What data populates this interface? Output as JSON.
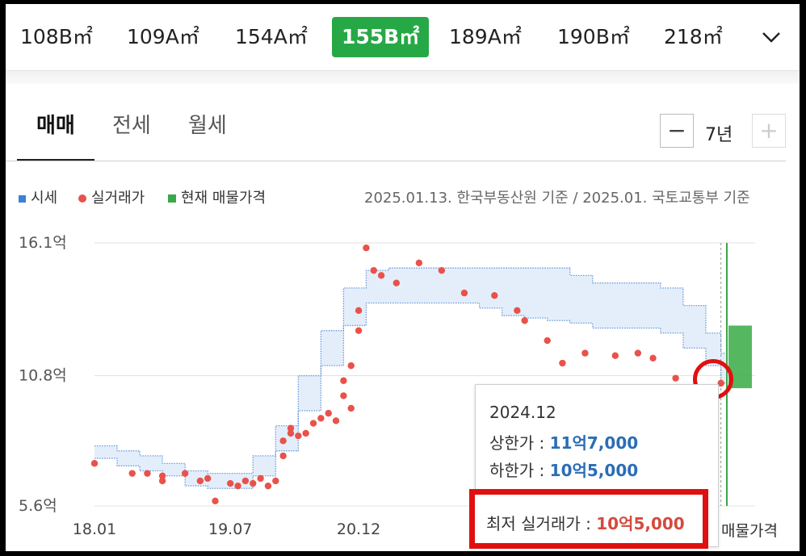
{
  "area_tabs": [
    {
      "label": "108B㎡",
      "active": false
    },
    {
      "label": "109A㎡",
      "active": false
    },
    {
      "label": "154A㎡",
      "active": false
    },
    {
      "label": "155B㎡",
      "active": true
    },
    {
      "label": "189A㎡",
      "active": false
    },
    {
      "label": "190B㎡",
      "active": false
    },
    {
      "label": "218㎡",
      "active": false
    }
  ],
  "deal_tabs": [
    {
      "label": "매매",
      "active": true
    },
    {
      "label": "전세",
      "active": false
    },
    {
      "label": "월세",
      "active": false
    }
  ],
  "period": {
    "minus": "−",
    "value": "7년",
    "plus": "+"
  },
  "legend": {
    "market_price": "시세",
    "actual_deal": "실거래가",
    "current_listing": "현재 매물가격",
    "basis": "2025.01.13. 한국부동산원 기준 / 2025.01. 국토교통부 기준"
  },
  "colors": {
    "accent": "#27a846",
    "market": "#3b82d6",
    "deal": "#e8524a",
    "listing": "#3aa84a",
    "annotation": "#e01010"
  },
  "tooltip": {
    "date": "2024.12",
    "upper_label": "상한가 : ",
    "upper_value": "11억7,000",
    "lower_label": "하한가 : ",
    "lower_value": "10억5,000",
    "min_label": "최저 실거래가 : ",
    "min_value": "10억5,000"
  },
  "chart_data": {
    "type": "scatter",
    "xlabel": "",
    "ylabel": "",
    "x_ticks": [
      "18.01",
      "19.07",
      "20.12"
    ],
    "current_listing_label": "매물가격",
    "y_ticks": [
      "16.1억",
      "10.8억",
      "5.6억"
    ],
    "y_tick_values": [
      16.1,
      10.8,
      5.6
    ],
    "ylim": [
      5.6,
      16.1
    ],
    "xlim": [
      "2018-01",
      "2025-01"
    ],
    "grid": true,
    "market_band": {
      "name": "시세",
      "x": [
        "2018-01",
        "2018-04",
        "2018-07",
        "2018-10",
        "2019-01",
        "2019-04",
        "2019-07",
        "2019-10",
        "2020-01",
        "2020-04",
        "2020-07",
        "2020-10",
        "2021-01",
        "2021-04",
        "2021-07",
        "2021-10",
        "2022-01",
        "2022-04",
        "2022-07",
        "2022-10",
        "2023-01",
        "2023-04",
        "2023-07",
        "2023-10",
        "2024-01",
        "2024-04",
        "2024-07",
        "2024-10",
        "2024-12"
      ],
      "upper": [
        8.0,
        7.8,
        7.6,
        7.3,
        7.0,
        6.9,
        6.9,
        7.6,
        8.8,
        10.8,
        12.6,
        14.3,
        15.0,
        15.1,
        15.1,
        15.1,
        15.1,
        15.1,
        15.1,
        15.1,
        15.1,
        14.8,
        14.5,
        14.5,
        14.5,
        14.3,
        13.6,
        12.5,
        11.7
      ],
      "lower": [
        7.5,
        7.2,
        7.0,
        6.8,
        6.4,
        6.3,
        6.3,
        6.8,
        7.8,
        9.4,
        11.2,
        12.8,
        13.7,
        13.7,
        13.7,
        13.7,
        13.7,
        13.5,
        13.2,
        13.1,
        13.0,
        12.9,
        12.7,
        12.7,
        12.7,
        12.5,
        11.9,
        11.2,
        10.5
      ]
    },
    "series": [
      {
        "name": "실거래가",
        "points": [
          [
            "2018-01",
            7.3
          ],
          [
            "2018-06",
            6.9
          ],
          [
            "2018-08",
            6.9
          ],
          [
            "2018-10",
            6.8
          ],
          [
            "2018-10",
            6.6
          ],
          [
            "2019-01",
            6.9
          ],
          [
            "2019-03",
            6.6
          ],
          [
            "2019-04",
            6.7
          ],
          [
            "2019-05",
            5.8
          ],
          [
            "2019-07",
            6.5
          ],
          [
            "2019-08",
            6.4
          ],
          [
            "2019-09",
            6.6
          ],
          [
            "2019-10",
            6.5
          ],
          [
            "2019-11",
            6.7
          ],
          [
            "2019-12",
            6.4
          ],
          [
            "2020-01",
            6.6
          ],
          [
            "2020-02",
            7.6
          ],
          [
            "2020-02",
            8.2
          ],
          [
            "2020-03",
            8.5
          ],
          [
            "2020-03",
            8.7
          ],
          [
            "2020-04",
            8.4
          ],
          [
            "2020-05",
            8.5
          ],
          [
            "2020-06",
            8.9
          ],
          [
            "2020-07",
            9.1
          ],
          [
            "2020-08",
            9.3
          ],
          [
            "2020-09",
            9.0
          ],
          [
            "2020-10",
            10.0
          ],
          [
            "2020-10",
            10.6
          ],
          [
            "2020-11",
            9.5
          ],
          [
            "2020-11",
            11.2
          ],
          [
            "2020-12",
            12.6
          ],
          [
            "2020-12",
            13.4
          ],
          [
            "2021-01",
            15.9
          ],
          [
            "2021-02",
            15.0
          ],
          [
            "2021-03",
            14.8
          ],
          [
            "2021-05",
            14.5
          ],
          [
            "2021-08",
            15.3
          ],
          [
            "2021-11",
            15.0
          ],
          [
            "2022-02",
            14.1
          ],
          [
            "2022-06",
            14.0
          ],
          [
            "2022-09",
            13.4
          ],
          [
            "2022-10",
            13.0
          ],
          [
            "2023-01",
            12.2
          ],
          [
            "2023-03",
            11.3
          ],
          [
            "2023-06",
            11.7
          ],
          [
            "2023-10",
            11.6
          ],
          [
            "2024-01",
            11.7
          ],
          [
            "2024-03",
            11.5
          ],
          [
            "2024-06",
            10.7
          ],
          [
            "2024-08",
            10.3
          ],
          [
            "2024-12",
            10.5
          ]
        ]
      }
    ]
  }
}
